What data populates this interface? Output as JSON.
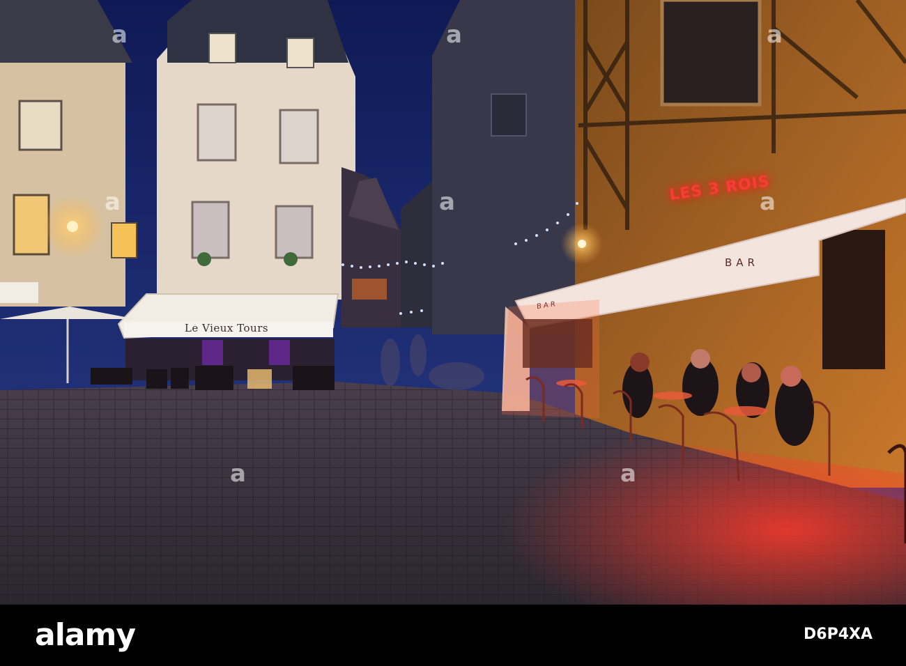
{
  "scene": {
    "signs": {
      "cafe_left": "Le Vieux Tours",
      "awning_right": "BAR",
      "awning_side": "BAR",
      "neon": "LES 3 ROIS"
    },
    "colors": {
      "sky": "#1c2a6e",
      "stone_facade": "#d9c7a8",
      "warm_light": "#f4b24a",
      "red_light": "#e0302a",
      "cobbles": "#3a3440"
    }
  },
  "footer": {
    "logo": "alamy",
    "image_id": "D6P4XA"
  }
}
